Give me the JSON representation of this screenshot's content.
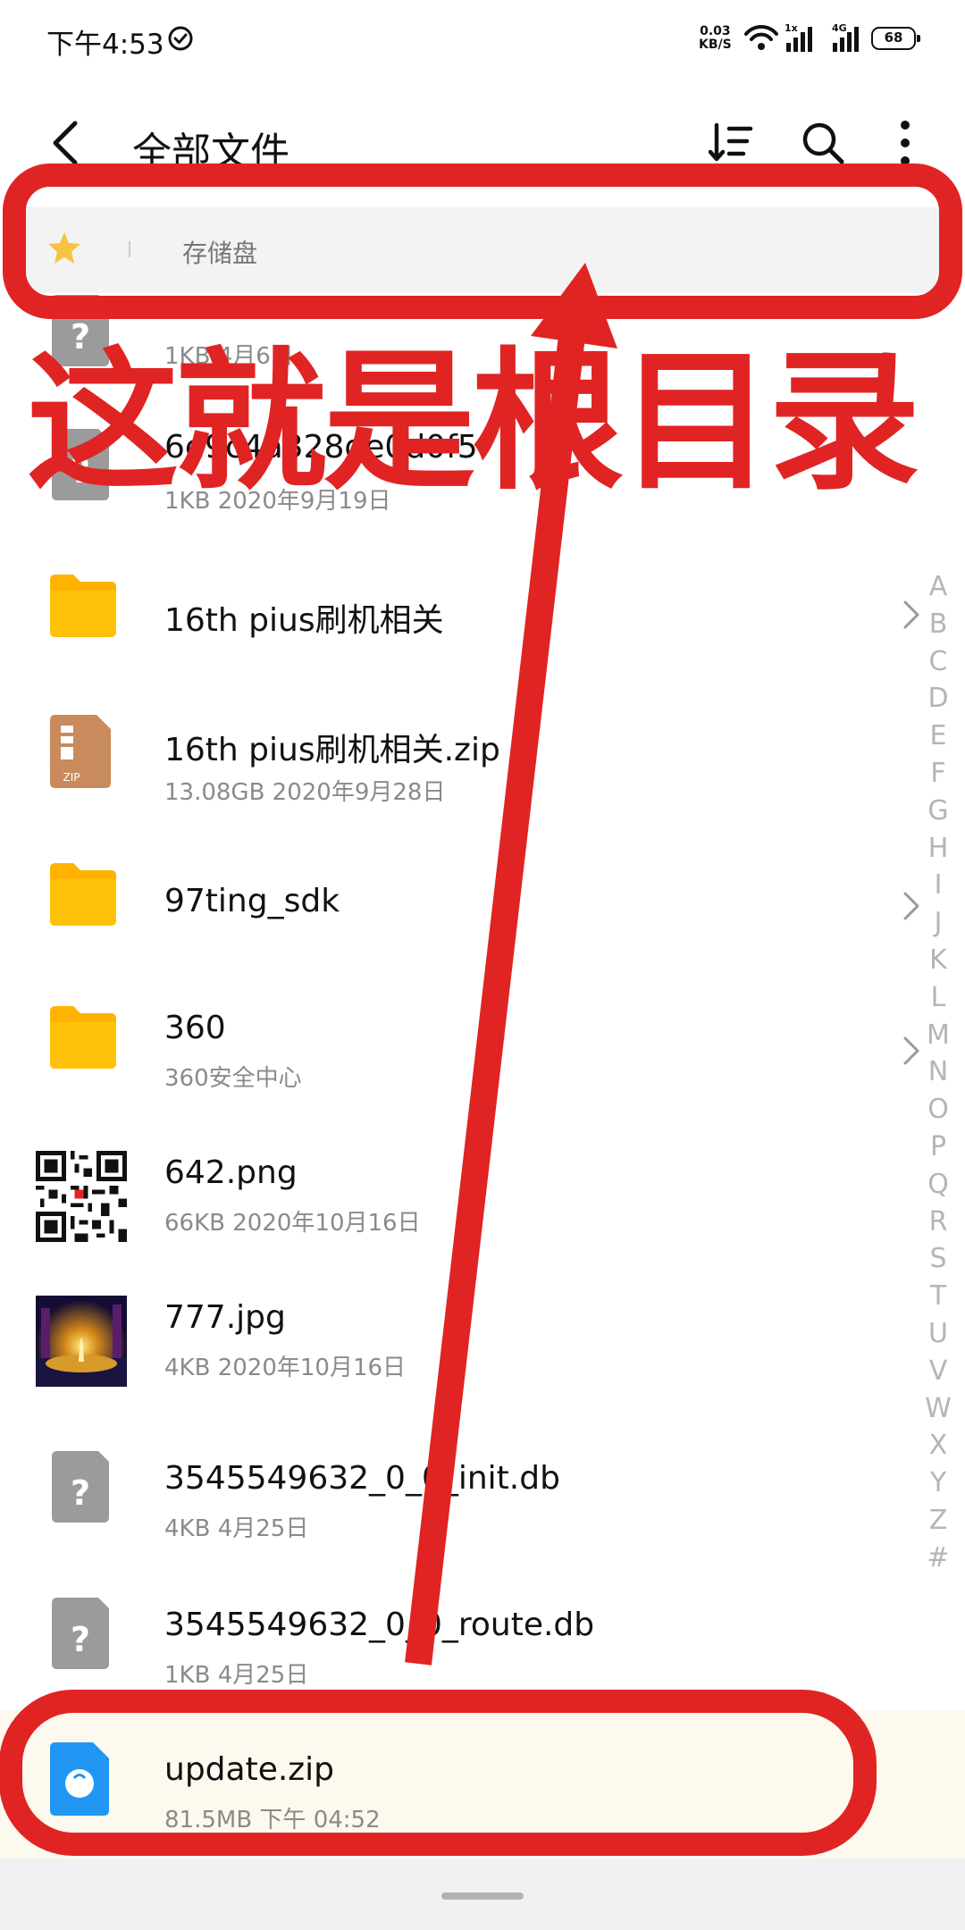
{
  "status_bar": {
    "time": "下午4:53",
    "net_speed_value": "0.03",
    "net_speed_unit": "KB/S",
    "battery": "68"
  },
  "app_bar": {
    "title": "全部文件",
    "icons": [
      "back-icon",
      "sort-icon",
      "search-icon",
      "more-icon"
    ]
  },
  "breadcrumb": {
    "items": [
      "存储盘"
    ]
  },
  "files": [
    {
      "name": "",
      "meta": "1KB  4月6日",
      "icon": "unknown-file-icon"
    },
    {
      "name": "6e9c4a328de0d0f5",
      "meta": "1KB  2020年9月19日",
      "icon": "unknown-file-icon"
    },
    {
      "name": "16th pius刷机相关",
      "meta": "",
      "icon": "folder-icon"
    },
    {
      "name": "16th pius刷机相关.zip",
      "meta": "13.08GB  2020年9月28日",
      "icon": "zip-file-icon"
    },
    {
      "name": "97ting_sdk",
      "meta": "",
      "icon": "folder-icon"
    },
    {
      "name": "360",
      "meta": "360安全中心",
      "icon": "folder-icon"
    },
    {
      "name": "642.png",
      "meta": "66KB  2020年10月16日",
      "icon": "qr-thumbnail"
    },
    {
      "name": "777.jpg",
      "meta": "4KB  2020年10月16日",
      "icon": "photo-thumbnail"
    },
    {
      "name": "3545549632_0_0_init.db",
      "meta": "4KB  4月25日",
      "icon": "unknown-file-icon"
    },
    {
      "name": "3545549632_0_0_route.db",
      "meta": "1KB  4月25日",
      "icon": "unknown-file-icon"
    },
    {
      "name": "update.zip",
      "meta": "81.5MB  下午 04:52",
      "icon": "package-file-icon"
    }
  ],
  "alpha_index": [
    "A",
    "B",
    "C",
    "D",
    "E",
    "F",
    "G",
    "H",
    "I",
    "J",
    "K",
    "L",
    "M",
    "N",
    "O",
    "P",
    "Q",
    "R",
    "S",
    "T",
    "U",
    "V",
    "W",
    "X",
    "Y",
    "Z",
    "#"
  ],
  "annotation": {
    "text": "这就是根目录",
    "color": "#e02423"
  },
  "colors": {
    "folder": "#ffb300",
    "highlight_band": "#fdf9ee",
    "annotation": "#e02423"
  }
}
